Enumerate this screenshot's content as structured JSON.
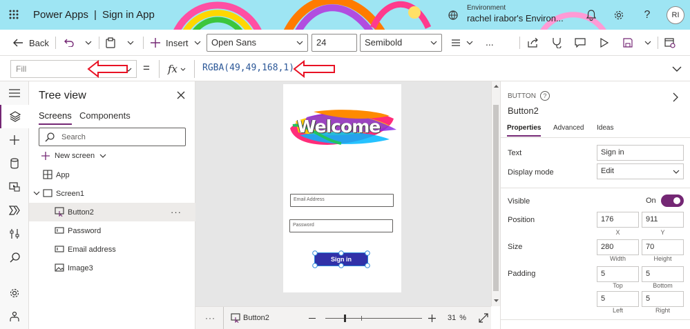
{
  "header": {
    "app_name": "Power Apps",
    "separator": "|",
    "doc_title": "Sign in App",
    "env_label": "Environment",
    "env_name": "rachel irabor's Environ...",
    "avatar_initials": "RI",
    "help": "?"
  },
  "toolbar": {
    "back": "Back",
    "insert": "Insert",
    "font": "Open Sans",
    "font_size": "24",
    "font_weight": "Semibold",
    "more": "..."
  },
  "formula": {
    "property": "Fill",
    "placeholder": "Fill",
    "equals": "=",
    "fx": "fx",
    "value": "RGBA(49,49,168,1)"
  },
  "tree": {
    "title": "Tree view",
    "tabs": [
      "Screens",
      "Components"
    ],
    "search_placeholder": "Search",
    "new_screen": "New screen",
    "items": [
      {
        "label": "App"
      },
      {
        "label": "Screen1"
      },
      {
        "label": "Button2"
      },
      {
        "label": "Password"
      },
      {
        "label": "Email address"
      },
      {
        "label": "Image3"
      }
    ],
    "row_menu": "···"
  },
  "canvas": {
    "welcome": "Welcome",
    "email_placeholder": "Email Address",
    "password_placeholder": "Password",
    "signin": "Sign in",
    "button_color": "#3131a8"
  },
  "statusbar": {
    "more": "···",
    "selected": "Button2",
    "zoom": "31",
    "zoom_unit": "%",
    "zoom_fraction": 0.19
  },
  "props": {
    "type": "BUTTON",
    "help": "?",
    "name": "Button2",
    "tabs": [
      "Properties",
      "Advanced",
      "Ideas"
    ],
    "text_label": "Text",
    "text_value": "Sign in",
    "display_label": "Display mode",
    "display_value": "Edit",
    "visible_label": "Visible",
    "visible_value": "On",
    "position_label": "Position",
    "pos_x": "176",
    "pos_y": "911",
    "cap_x": "X",
    "cap_y": "Y",
    "size_label": "Size",
    "width": "280",
    "height": "70",
    "cap_width": "Width",
    "cap_height": "Height",
    "padding_label": "Padding",
    "pad_top": "5",
    "pad_bottom": "5",
    "pad_left": "5",
    "pad_right": "5",
    "cap_top": "Top",
    "cap_bottom": "Bottom",
    "cap_left": "Left",
    "cap_right": "Right"
  },
  "colors": {
    "accent": "#742774",
    "header_bg": "#9ee5f3",
    "arrow": "#e81123",
    "formula_text": "#2b5797"
  }
}
